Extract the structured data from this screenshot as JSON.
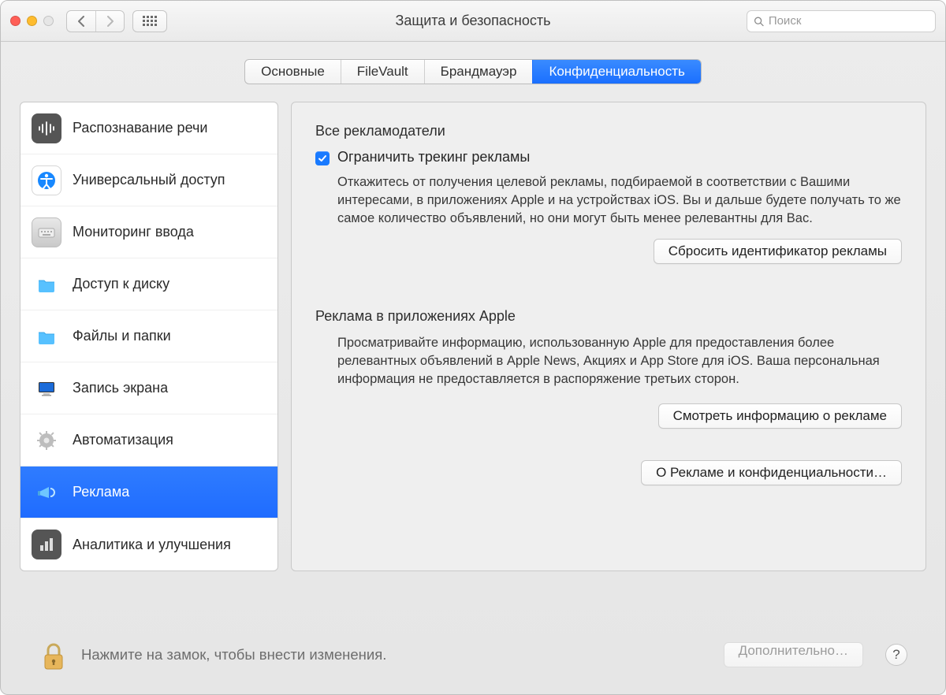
{
  "window": {
    "title": "Защита и безопасность"
  },
  "search": {
    "placeholder": "Поиск"
  },
  "tabs": {
    "general": "Основные",
    "filevault": "FileVault",
    "firewall": "Брандмауэр",
    "privacy": "Конфиденциальность"
  },
  "sidebar": {
    "items": [
      {
        "label": "Распознавание речи"
      },
      {
        "label": "Универсальный доступ"
      },
      {
        "label": "Мониторинг ввода"
      },
      {
        "label": "Доступ к диску"
      },
      {
        "label": "Файлы и папки"
      },
      {
        "label": "Запись экрана"
      },
      {
        "label": "Автоматизация"
      },
      {
        "label": "Реклама"
      },
      {
        "label": "Аналитика и улучшения"
      }
    ]
  },
  "panel": {
    "advertisers_title": "Все рекламодатели",
    "limit_tracking_label": "Ограничить трекинг рекламы",
    "limit_tracking_desc": "Откажитесь от получения целевой рекламы, подбираемой в соответствии с Вашими интересами, в приложениях Apple и на устройствах iOS. Вы и дальше будете получать то же самое количество объявлений, но они могут быть менее релевантны для Вас.",
    "reset_button": "Сбросить идентификатор рекламы",
    "apple_ads_title": "Реклама в приложениях Apple",
    "apple_ads_desc": "Просматривайте информацию, использованную Apple для предоставления более релевантных объявлений в Apple News, Акциях и App Store для iOS. Ваша персональная информация не предоставляется в распоряжение третьих сторон.",
    "view_info_button": "Смотреть информацию о рекламе",
    "about_button": "О Рекламе и конфиденциальности…"
  },
  "footer": {
    "lock_text": "Нажмите на замок, чтобы внести изменения.",
    "advanced": "Дополнительно…",
    "help": "?"
  }
}
